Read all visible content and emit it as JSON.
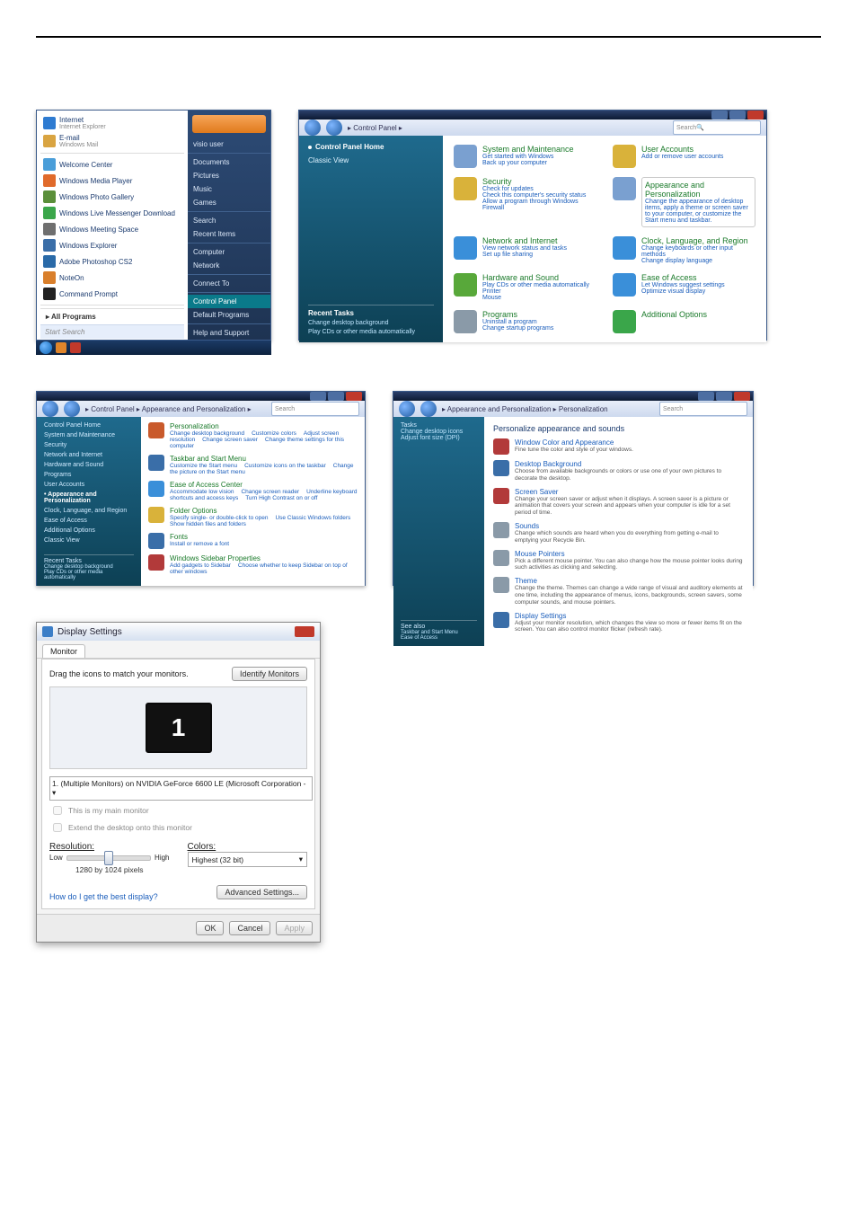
{
  "start_menu": {
    "items": [
      {
        "label": "Internet",
        "sub": "Internet Explorer",
        "color": "#2e7bd1"
      },
      {
        "label": "E-mail",
        "sub": "Windows Mail",
        "color": "#d9a441"
      },
      {
        "label": "Welcome Center",
        "sub": "",
        "color": "#4a9ed9"
      },
      {
        "label": "Windows Media Player",
        "sub": "",
        "color": "#e06a2b"
      },
      {
        "label": "Windows Photo Gallery",
        "sub": "",
        "color": "#5a8f3a"
      },
      {
        "label": "Windows Live Messenger Download",
        "sub": "",
        "color": "#3aa64a"
      },
      {
        "label": "Windows Meeting Space",
        "sub": "",
        "color": "#6f6f6f"
      },
      {
        "label": "Windows Explorer",
        "sub": "",
        "color": "#3a6ea8"
      },
      {
        "label": "Adobe Photoshop CS2",
        "sub": "",
        "color": "#2a6aa8"
      },
      {
        "label": "NoteOn",
        "sub": "",
        "color": "#d97f2b"
      },
      {
        "label": "Command Prompt",
        "sub": "",
        "color": "#222"
      }
    ],
    "all_programs": "All Programs",
    "search_placeholder": "Start Search",
    "right": [
      "visio user",
      "Documents",
      "Pictures",
      "Music",
      "Games",
      "Search",
      "Recent Items",
      "Computer",
      "Network",
      "Connect To",
      "Control Panel",
      "Default Programs",
      "Help and Support"
    ],
    "highlight_index": 10
  },
  "control_panel": {
    "breadcrumb": "▸ Control Panel ▸",
    "search_placeholder": "Search",
    "side": {
      "home": "Control Panel Home",
      "classic": "Classic View",
      "recent_title": "Recent Tasks",
      "recent": [
        "Change desktop background",
        "Play CDs or other media automatically"
      ]
    },
    "cats": [
      {
        "title": "System and Maintenance",
        "links": [
          "Get started with Windows",
          "Back up your computer"
        ],
        "icon": "#3aa64a"
      },
      {
        "title": "User Accounts",
        "links": [
          "Add or remove user accounts"
        ],
        "icon": "#3aa64a",
        "iconbg": "#d9b23a"
      },
      {
        "title": "Security",
        "links": [
          "Check for updates",
          "Check this computer's security status",
          "Allow a program through Windows Firewall"
        ],
        "icon": "#3aa64a",
        "iconbg": "#d9b23a"
      },
      {
        "title": "Appearance and Personalization",
        "links": [
          "Change the appearance of desktop items, apply a theme or screen saver to your computer, or customize the Start menu and taskbar."
        ],
        "icon": "#b23a3a",
        "border": true
      },
      {
        "title": "Network and Internet",
        "links": [
          "View network status and tasks",
          "Set up file sharing"
        ],
        "icon": "#3aa64a",
        "iconbg": "#3a8fd9"
      },
      {
        "title": "Clock, Language, and Region",
        "links": [
          "Change keyboards or other input methods",
          "Change display language"
        ],
        "icon": "#3aa64a",
        "iconbg": "#3a8fd9"
      },
      {
        "title": "Hardware and Sound",
        "links": [
          "Play CDs or other media automatically",
          "Printer",
          "Mouse"
        ],
        "icon": "#3aa64a",
        "iconbg": "#58a83a"
      },
      {
        "title": "Ease of Access",
        "links": [
          "Let Windows suggest settings",
          "Optimize visual display"
        ],
        "icon": "#3aa64a",
        "iconbg": "#3a8fd9"
      },
      {
        "title": "Programs",
        "links": [
          "Uninstall a program",
          "Change startup programs"
        ],
        "icon": "#3aa64a",
        "iconbg": "#8a9aa8"
      },
      {
        "title": "Additional Options",
        "links": [],
        "icon": "#3aa64a",
        "iconbg": "#3aa64a"
      }
    ]
  },
  "appearance_list": {
    "breadcrumb": "▸ Control Panel ▸ Appearance and Personalization ▸",
    "search_placeholder": "Search",
    "side": [
      "Control Panel Home",
      "System and Maintenance",
      "Security",
      "Network and Internet",
      "Hardware and Sound",
      "Programs",
      "User Accounts",
      "Appearance and Personalization",
      "Clock, Language, and Region",
      "Ease of Access",
      "Additional Options",
      "Classic View"
    ],
    "side_selected": "Appearance and Personalization",
    "recent_title": "Recent Tasks",
    "recent": [
      "Change desktop background",
      "Play CDs or other media automatically"
    ],
    "entries": [
      {
        "title": "Personalization",
        "links": [
          "Change desktop background",
          "Customize colors",
          "Adjust screen resolution",
          "Change screen saver",
          "Change theme settings for this computer"
        ],
        "color": "#c95a2b"
      },
      {
        "title": "Taskbar and Start Menu",
        "links": [
          "Customize the Start menu",
          "Customize icons on the taskbar",
          "Change the picture on the Start menu"
        ],
        "color": "#3a6ea8"
      },
      {
        "title": "Ease of Access Center",
        "links": [
          "Accommodate low vision",
          "Change screen reader",
          "Underline keyboard shortcuts and access keys",
          "Turn High Contrast on or off"
        ],
        "color": "#3a8fd9"
      },
      {
        "title": "Folder Options",
        "links": [
          "Specify single- or double-click to open",
          "Use Classic Windows folders",
          "Show hidden files and folders"
        ],
        "color": "#d9b23a"
      },
      {
        "title": "Fonts",
        "links": [
          "Install or remove a font"
        ],
        "color": "#3a6ea8"
      },
      {
        "title": "Windows Sidebar Properties",
        "links": [
          "Add gadgets to Sidebar",
          "Choose whether to keep Sidebar on top of other windows"
        ],
        "color": "#b23a3a"
      }
    ]
  },
  "personalization": {
    "breadcrumb": "▸ Appearance and Personalization ▸ Personalization",
    "search_placeholder": "Search",
    "side_title": "Tasks",
    "side": [
      "Change desktop icons",
      "Adjust font size (DPI)"
    ],
    "see_also": "See also",
    "see_also_items": [
      "Taskbar and Start Menu",
      "Ease of Access"
    ],
    "heading": "Personalize appearance and sounds",
    "rows": [
      {
        "title": "Window Color and Appearance",
        "desc": "Fine tune the color and style of your windows.",
        "color": "#b23a3a"
      },
      {
        "title": "Desktop Background",
        "desc": "Choose from available backgrounds or colors or use one of your own pictures to decorate the desktop.",
        "color": "#3a6ea8"
      },
      {
        "title": "Screen Saver",
        "desc": "Change your screen saver or adjust when it displays. A screen saver is a picture or animation that covers your screen and appears when your computer is idle for a set period of time.",
        "color": "#b23a3a"
      },
      {
        "title": "Sounds",
        "desc": "Change which sounds are heard when you do everything from getting e-mail to emptying your Recycle Bin.",
        "color": "#8a9aa8"
      },
      {
        "title": "Mouse Pointers",
        "desc": "Pick a different mouse pointer. You can also change how the mouse pointer looks during such activities as clicking and selecting.",
        "color": "#8a9aa8"
      },
      {
        "title": "Theme",
        "desc": "Change the theme. Themes can change a wide range of visual and auditory elements at one time, including the appearance of menus, icons, backgrounds, screen savers, some computer sounds, and mouse pointers.",
        "color": "#8a9aa8"
      },
      {
        "title": "Display Settings",
        "desc": "Adjust your monitor resolution, which changes the view so more or fewer items fit on the screen. You can also control monitor flicker (refresh rate).",
        "color": "#3a6ea8"
      }
    ]
  },
  "display_settings": {
    "title": "Display Settings",
    "tab": "Monitor",
    "instruction": "Drag the icons to match your monitors.",
    "identify_btn": "Identify Monitors",
    "monitor_num": "1",
    "monitor_select": "1. (Multiple Monitors) on NVIDIA GeForce 6600 LE (Microsoft Corporation - ▾",
    "chk_main": "This is my main monitor",
    "chk_extend": "Extend the desktop onto this monitor",
    "resolution_label": "Resolution:",
    "low": "Low",
    "high": "High",
    "res_value": "1280 by 1024 pixels",
    "colors_label": "Colors:",
    "colors_value": "Highest (32 bit)",
    "help_link": "How do I get the best display?",
    "adv_btn": "Advanced Settings...",
    "ok": "OK",
    "cancel": "Cancel",
    "apply": "Apply"
  }
}
